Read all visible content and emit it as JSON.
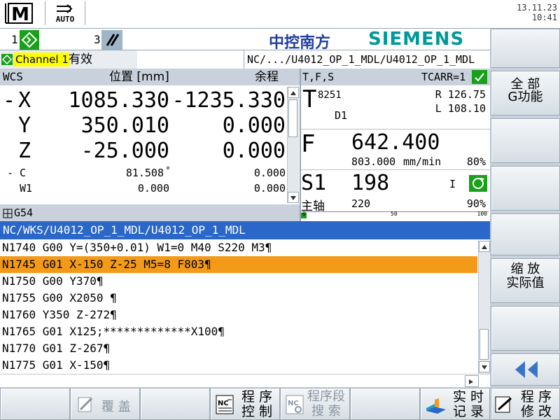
{
  "datetime": {
    "date": "13.11.23",
    "time": "10:41"
  },
  "mode": {
    "machine_label": "M",
    "auto_label": "AUTO"
  },
  "status": {
    "channel1_num": "1",
    "channel3_num": "3",
    "brand_cn": "中控南方",
    "brand": "SIEMENS"
  },
  "channel": {
    "name": "Channel 1",
    "state": "有效",
    "path": "NC/.../U4012_OP_1_MDL/U4012_OP_1_MDL"
  },
  "wcs": {
    "head_wcs": "WCS",
    "head_pos": "位置 [mm]",
    "head_rest": "余程",
    "axes": [
      {
        "sign": "-",
        "name": "X",
        "pos": "1085.330",
        "rest": "-1235.330"
      },
      {
        "sign": "",
        "name": "Y",
        "pos": "350.010",
        "rest": "0.000"
      },
      {
        "sign": "",
        "name": "Z",
        "pos": "-25.000",
        "rest": "0.000"
      }
    ],
    "small_axes": [
      {
        "sign": "-",
        "name": "C",
        "pos": "81.508",
        "unit": "°",
        "rest": "0.000"
      },
      {
        "sign": "",
        "name": "W1",
        "pos": "0.000",
        "unit": "",
        "rest": "0.000"
      }
    ],
    "frame": "G54"
  },
  "tfs": {
    "head": "T,F,S",
    "tcarr": "TCARR=1",
    "tool": {
      "label": "T",
      "number": "8251",
      "d": "D1",
      "r": "R 126.75",
      "l": "L 108.10"
    },
    "feed": {
      "label": "F",
      "value": "642.400",
      "sub": "803.000",
      "unit": "mm/min",
      "pct": "80%"
    },
    "spindle": {
      "label": "S1",
      "value": "198",
      "state": "I",
      "name": "主轴",
      "speed": "220",
      "pct": "90%",
      "scale0": "0",
      "scale50": "50",
      "scale100": "100",
      "fill": 0.03
    }
  },
  "program": {
    "title": "NC/WKS/U4012_OP_1_MDL/U4012_OP_1_MDL",
    "lines": [
      "N1740 G00 Y=(350+0.01) W1=0 M40 S220 M3¶",
      "N1745 G01 X-150 Z-25 M5=8 F803¶",
      "N1750 G00 Y370¶",
      "N1755 G00 X2050 ¶",
      "N1760 Y350 Z-272¶",
      "N1765 G01 X125;*************X100¶",
      "N1770 G01 Z-267¶",
      "N1775 G01 X-150¶"
    ],
    "active_index": 1
  },
  "softkeys_right": {
    "g_all_1": "全 部",
    "g_all_2": "G功能",
    "zoom_1": "缩 放",
    "zoom_2": "实际值"
  },
  "softkeys_bottom": {
    "overwrite": "覆 盖",
    "prog_ctrl_1": "程 序",
    "prog_ctrl_2": "控 制",
    "block_search_1": "程序段",
    "block_search_2": "搜 索",
    "rt_record_1": "实 时",
    "rt_record_2": "记 录",
    "prog_mod_1": "程 序",
    "prog_mod_2": "修 改"
  },
  "colors": {
    "accent_blue": "#2a67c8",
    "active_line": "#f39a18",
    "siemens_teal": "#009999",
    "ok_green": "#1aa01a",
    "brand_blue": "#1f3fa0"
  }
}
